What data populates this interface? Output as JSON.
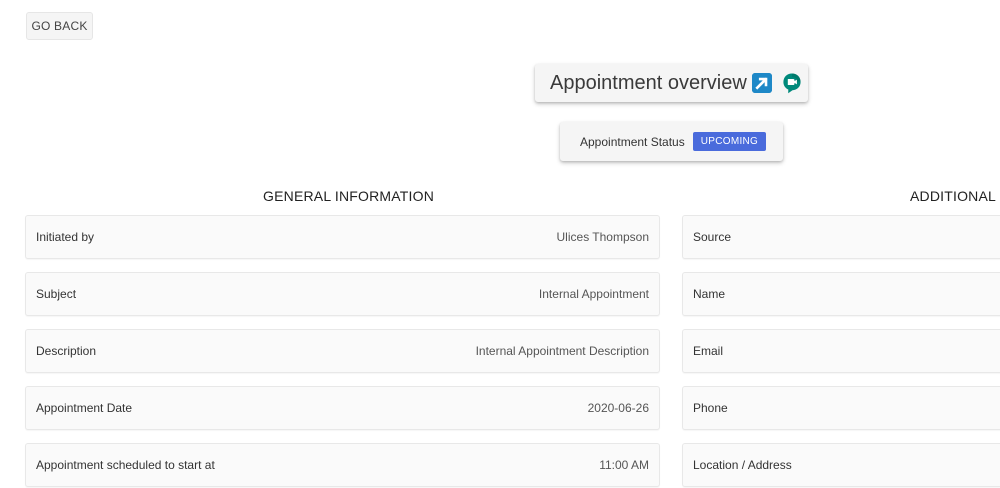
{
  "go_back": {
    "label": "GO BACK"
  },
  "overview": {
    "title": "Appointment overview",
    "icons": [
      "external-link-icon",
      "google-meet-icon"
    ]
  },
  "status": {
    "label": "Appointment Status",
    "value": "UPCOMING",
    "badge_color": "#4a6bdc"
  },
  "general_information": {
    "title": "GENERAL INFORMATION",
    "rows": [
      {
        "label": "Initiated by",
        "value": "Ulices Thompson"
      },
      {
        "label": "Subject",
        "value": "Internal Appointment"
      },
      {
        "label": "Description",
        "value": "Internal Appointment Description"
      },
      {
        "label": "Appointment Date",
        "value": "2020-06-26"
      },
      {
        "label": "Appointment scheduled to start at",
        "value": "11:00 AM"
      }
    ]
  },
  "additional_information": {
    "title": "ADDITIONAL I",
    "rows": [
      {
        "label": "Source"
      },
      {
        "label": "Name"
      },
      {
        "label": "Email"
      },
      {
        "label": "Phone"
      },
      {
        "label": "Location / Address"
      }
    ]
  },
  "colors": {
    "external_icon": "#1e88c7",
    "meet_green": "#00897b",
    "meet_dark_green": "#00695c",
    "row_background": "#fafafa",
    "row_border": "#e8e8e8"
  }
}
